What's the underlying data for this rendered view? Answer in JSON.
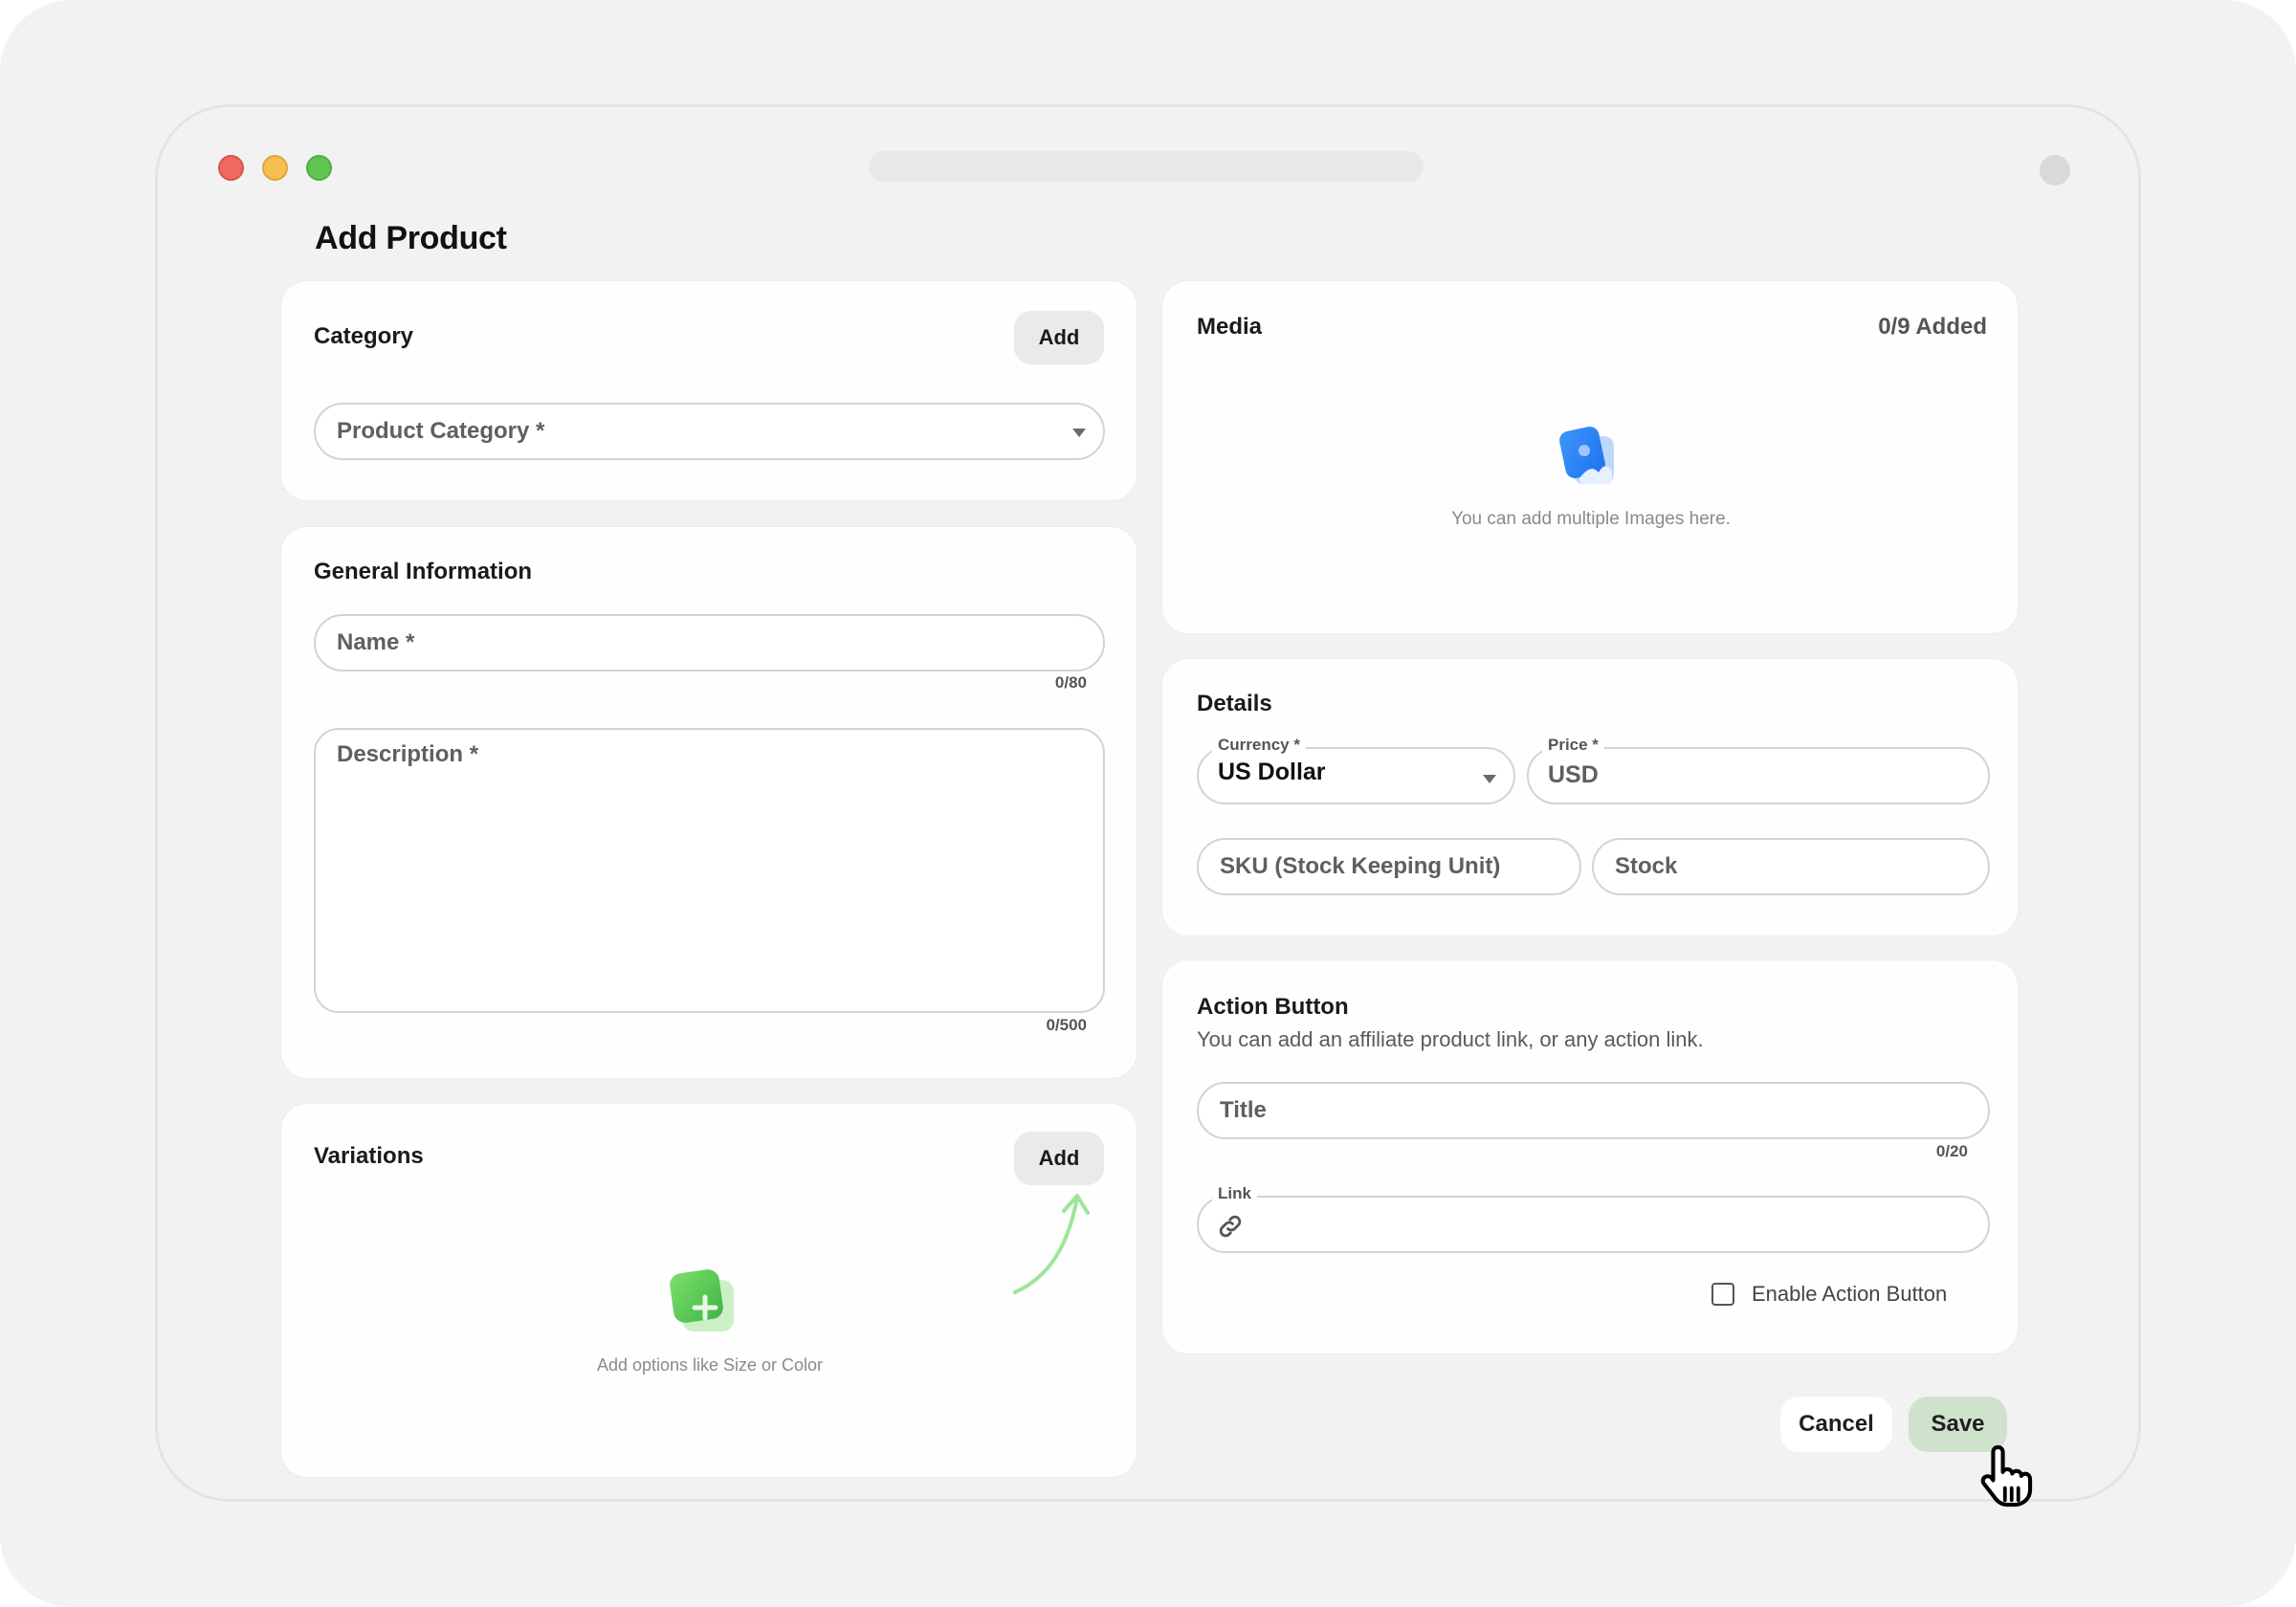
{
  "window": {
    "controls": [
      "close",
      "minimize",
      "maximize"
    ],
    "title": "Add Product"
  },
  "category": {
    "title": "Category",
    "add_label": "Add",
    "select_placeholder": "Product Category *"
  },
  "general": {
    "title": "General Information",
    "name_placeholder": "Name *",
    "name_counter": "0/80",
    "description_placeholder": "Description *",
    "description_counter": "0/500"
  },
  "variations": {
    "title": "Variations",
    "add_label": "Add",
    "empty_text": "Add options like Size or Color",
    "empty_icon": "add-variation-icon"
  },
  "media": {
    "title": "Media",
    "count": "0/9 Added",
    "empty_text": "You can add multiple Images here.",
    "empty_icon": "image-icon"
  },
  "details": {
    "title": "Details",
    "currency_label": "Currency *",
    "currency_value": "US Dollar",
    "price_label": "Price *",
    "price_placeholder": "USD",
    "sku_placeholder": "SKU (Stock Keeping Unit)",
    "stock_placeholder": "Stock"
  },
  "action_button": {
    "title": "Action Button",
    "subtitle": "You can add an affiliate product link, or any action link.",
    "title_placeholder": "Title",
    "title_counter": "0/20",
    "link_label": "Link",
    "link_icon": "link-icon",
    "enable_label": "Enable Action Button",
    "enable_checked": false
  },
  "footer": {
    "cancel_label": "Cancel",
    "save_label": "Save"
  },
  "colors": {
    "save_bg": "#CFE3CC",
    "media_icon": "#2F86F6",
    "variation_icon": "#4CC04A",
    "arrow": "#9EE59A"
  }
}
